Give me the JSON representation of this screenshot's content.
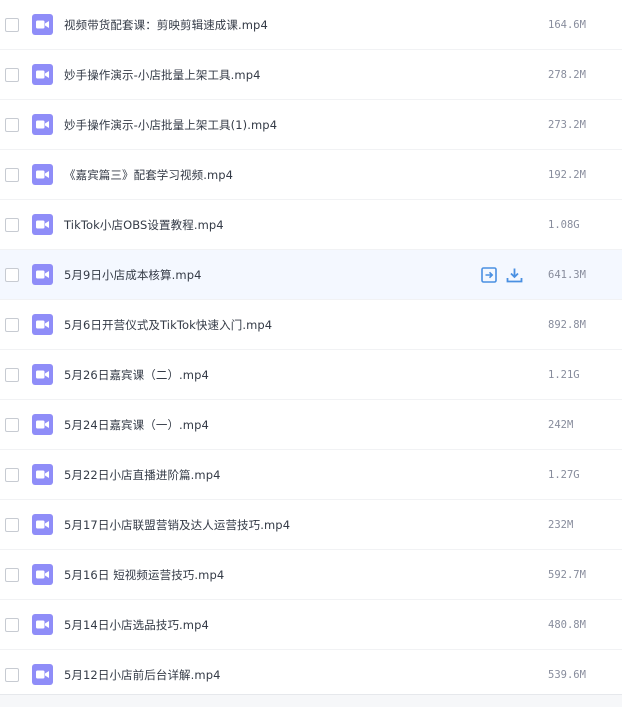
{
  "files": [
    {
      "name": "视频带货配套课：剪映剪辑速成课.mp4",
      "size": "164.6M"
    },
    {
      "name": "妙手操作演示-小店批量上架工具.mp4",
      "size": "278.2M"
    },
    {
      "name": "妙手操作演示-小店批量上架工具(1).mp4",
      "size": "273.2M"
    },
    {
      "name": "《嘉宾篇三》配套学习视频.mp4",
      "size": "192.2M"
    },
    {
      "name": "TikTok小店OBS设置教程.mp4",
      "size": "1.08G"
    },
    {
      "name": "5月9日小店成本核算.mp4",
      "size": "641.3M"
    },
    {
      "name": "5月6日开营仪式及TikTok快速入门.mp4",
      "size": "892.8M"
    },
    {
      "name": "5月26日嘉宾课（二）.mp4",
      "size": "1.21G"
    },
    {
      "name": "5月24日嘉宾课（一）.mp4",
      "size": "242M"
    },
    {
      "name": "5月22日小店直播进阶篇.mp4",
      "size": "1.27G"
    },
    {
      "name": "5月17日小店联盟营销及达人运营技巧.mp4",
      "size": "232M"
    },
    {
      "name": "5月16日 短视频运营技巧.mp4",
      "size": "592.7M"
    },
    {
      "name": "5月14日小店选品技巧.mp4",
      "size": "480.8M"
    },
    {
      "name": "5月12日小店前后台详解.mp4",
      "size": "539.6M"
    }
  ],
  "hover_row_index": 5,
  "icons": {
    "file": "video-file-icon",
    "share": "share-icon",
    "download": "download-icon"
  },
  "colors": {
    "file_icon": "#8f8df8",
    "action_icon": "#4a90e2",
    "hover_row": "#f4f8ff"
  }
}
